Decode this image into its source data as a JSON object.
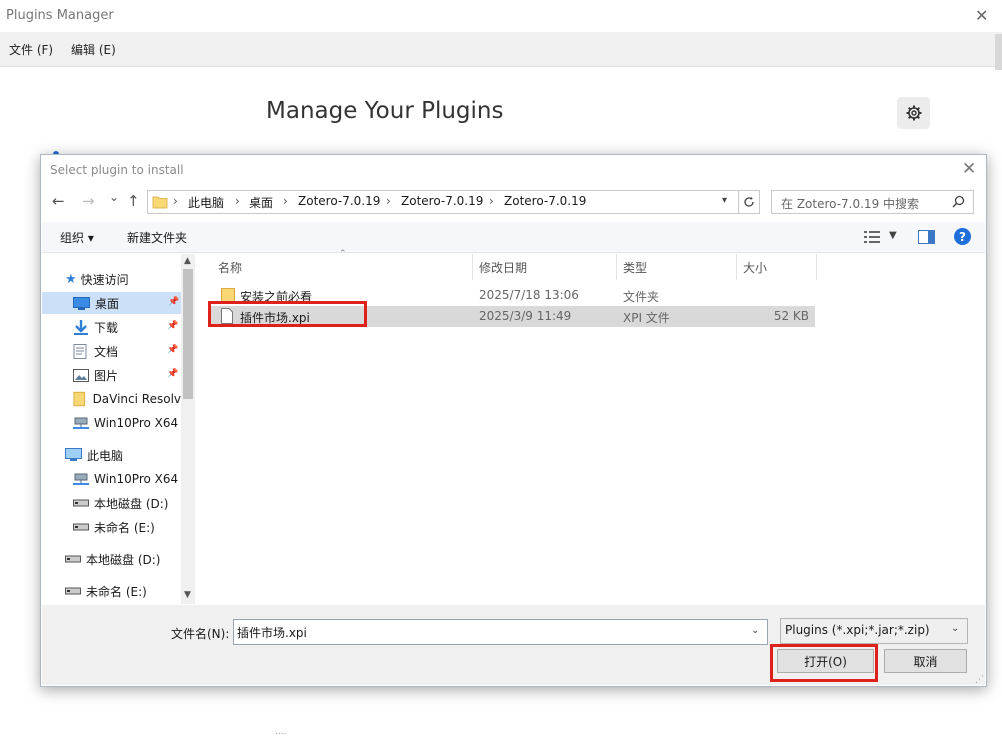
{
  "window": {
    "title": "Plugins Manager",
    "close_glyph": "✕",
    "menu": [
      "文件 (F)",
      "编辑 (E)"
    ],
    "heading": "Manage Your Plugins",
    "bottom_stub_text": "...."
  },
  "dialog": {
    "title": "Select plugin to install",
    "close_glyph": "✕",
    "nav": {
      "back": "←",
      "forward": "→",
      "recent": "⌄",
      "up": "↑"
    },
    "breadcrumb": [
      "此电脑",
      "桌面",
      "Zotero-7.0.19",
      "Zotero-7.0.19",
      "Zotero-7.0.19"
    ],
    "search_placeholder": "在 Zotero-7.0.19 中搜索",
    "toolbar": {
      "organize": "组织 ▾",
      "new_folder": "新建文件夹",
      "help": "?"
    },
    "nav_pane": {
      "quick_access": "快速访问",
      "quick_items": [
        {
          "label": "桌面",
          "icon": "desktop-icon",
          "pinned": true,
          "selected": true
        },
        {
          "label": "下载",
          "icon": "download-icon",
          "pinned": true,
          "selected": false
        },
        {
          "label": "文档",
          "icon": "document-icon",
          "pinned": true,
          "selected": false
        },
        {
          "label": "图片",
          "icon": "picture-icon",
          "pinned": true,
          "selected": false
        },
        {
          "label": "DaVinci Resolv",
          "icon": "folder-icon",
          "pinned": false,
          "selected": false
        },
        {
          "label": "Win10Pro X64",
          "icon": "network-drive-icon",
          "pinned": false,
          "selected": false
        }
      ],
      "this_pc": "此电脑",
      "pc_items": [
        "Win10Pro X64",
        "本地磁盘 (D:)",
        "未命名 (E:)"
      ],
      "drives": [
        "本地磁盘 (D:)",
        "未命名 (E:)"
      ]
    },
    "columns": [
      "名称",
      "修改日期",
      "类型",
      "大小"
    ],
    "files": [
      {
        "name": "安装之前必看",
        "date": "2025/7/18 13:06",
        "type": "文件夹",
        "size": "",
        "icon": "folder-icon"
      },
      {
        "name": "插件市场.xpi",
        "date": "2025/3/9 11:49",
        "type": "XPI 文件",
        "size": "52 KB",
        "icon": "file-icon"
      }
    ],
    "footer": {
      "filename_label": "文件名(N):",
      "filename_value": "插件市场.xpi",
      "filter": "Plugins (*.xpi;*.jar;*.zip)",
      "open": "打开(O)",
      "cancel": "取消"
    }
  },
  "colors": {
    "highlight_red": "#e0201a",
    "selection_blue": "#cce0f7",
    "folder_yellow": "#f8d775",
    "help_blue": "#1e6fd9"
  }
}
